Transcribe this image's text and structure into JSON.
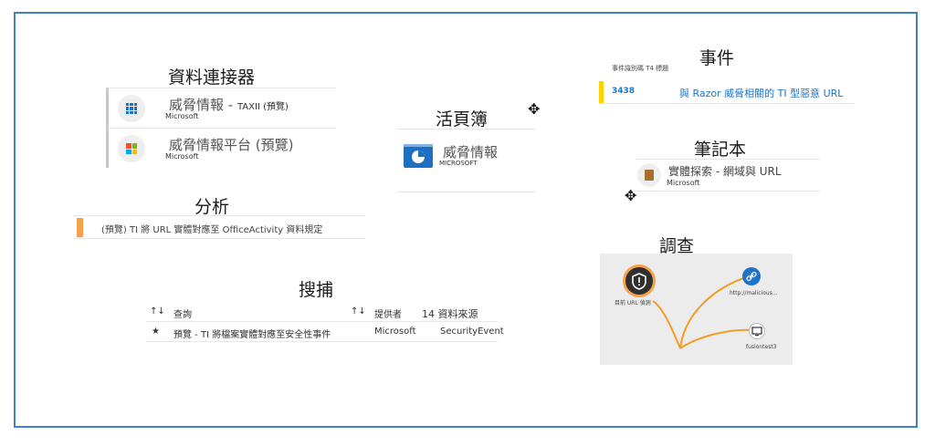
{
  "sections": {
    "data_connectors": "資料連接器",
    "workbooks": "活頁簿",
    "analytics": "分析",
    "hunting": "搜捕",
    "incidents": "事件",
    "notebooks": "筆記本",
    "investigation": "調查"
  },
  "connectors": [
    {
      "name": "威脅情報 -",
      "suffix": "TAXII (預覽)",
      "publisher": "Microsoft",
      "icon": "grid-icon"
    },
    {
      "name": "威脅情報平台 (預覽)",
      "suffix": "",
      "publisher": "Microsoft",
      "icon": "microsoft-logo-icon"
    }
  ],
  "workbook": {
    "name": "威脅情報",
    "publisher": "MICROSOFT",
    "icon": "workbook-icon"
  },
  "analytics": {
    "rule_text": "(預覽) TI 將 URL 實體對應至 OfficeActivity 資料規定"
  },
  "hunting": {
    "headers": {
      "query": "查詢",
      "provider": "提供者",
      "datasource": "14 資料來源",
      "sort_icon": "↑↓"
    },
    "rows": [
      {
        "star": "★",
        "query": "預覽 - TI 將檔案實體對應至安全性事件",
        "provider": "Microsoft",
        "datasource": "SecurityEvent"
      }
    ]
  },
  "incidents": {
    "header": "事件識別碼 T4 標題",
    "rows": [
      {
        "id": "3438",
        "title": "與 Razor 威脅相關的 TI 型惡意 URL"
      }
    ]
  },
  "notebook": {
    "name": "實體探索 - 網域與 URL",
    "publisher": "Microsoft"
  },
  "investigation": {
    "nodes": [
      {
        "label": "目前 URL 偵測",
        "icon": "shield-icon"
      },
      {
        "label": "http://malicious...",
        "icon": "link-icon"
      },
      {
        "label": "fusiontest3",
        "icon": "computer-icon"
      }
    ]
  },
  "colors": {
    "frame": "#3f80c8",
    "accent_orange": "#f7a24b",
    "incident_yellow": "#ffd200",
    "link_blue": "#1e73c9"
  }
}
